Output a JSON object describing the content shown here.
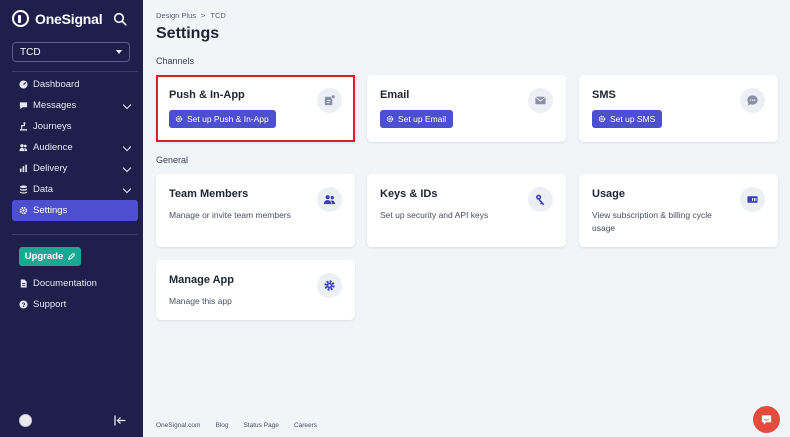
{
  "sidebar": {
    "brand": "OneSignal",
    "app_select": "TCD",
    "nav": [
      {
        "label": "Dashboard",
        "icon": "dashboard-icon",
        "expandable": false,
        "active": false
      },
      {
        "label": "Messages",
        "icon": "messages-icon",
        "expandable": true,
        "active": false
      },
      {
        "label": "Journeys",
        "icon": "journeys-icon",
        "expandable": false,
        "active": false
      },
      {
        "label": "Audience",
        "icon": "audience-icon",
        "expandable": true,
        "active": false
      },
      {
        "label": "Delivery",
        "icon": "delivery-icon",
        "expandable": true,
        "active": false
      },
      {
        "label": "Data",
        "icon": "data-icon",
        "expandable": true,
        "active": false
      },
      {
        "label": "Settings",
        "icon": "settings-icon",
        "expandable": false,
        "active": true
      }
    ],
    "upgrade_label": "Upgrade",
    "secondary_nav": [
      {
        "label": "Documentation",
        "icon": "documentation-icon"
      },
      {
        "label": "Support",
        "icon": "support-icon"
      }
    ]
  },
  "header": {
    "breadcrumb": [
      "Design Plus",
      "TCD"
    ],
    "breadcrumb_separator": ">",
    "title": "Settings"
  },
  "channels": {
    "label": "Channels",
    "cards": [
      {
        "title": "Push & In-App",
        "button": "Set up Push & In-App",
        "icon": "push-notification-icon"
      },
      {
        "title": "Email",
        "button": "Set up Email",
        "icon": "email-icon"
      },
      {
        "title": "SMS",
        "button": "Set up SMS",
        "icon": "sms-icon"
      }
    ]
  },
  "general": {
    "label": "General",
    "cards": [
      {
        "title": "Team Members",
        "desc": "Manage or invite team members",
        "icon": "team-icon"
      },
      {
        "title": "Keys & IDs",
        "desc": "Set up security and API keys",
        "icon": "keys-icon"
      },
      {
        "title": "Usage",
        "desc": "View subscription & billing cycle usage",
        "icon": "usage-icon"
      },
      {
        "title": "Manage App",
        "desc": "Manage this app",
        "icon": "gear-icon"
      }
    ]
  },
  "footer": {
    "links": [
      "OneSignal.com",
      "Blog",
      "Status Page",
      "Careers"
    ]
  },
  "colors": {
    "sidebar_bg": "#1e1f4b",
    "accent": "#4c4fcf",
    "upgrade": "#18a993",
    "highlight": "#d6202a",
    "chat": "#e54b3c"
  }
}
